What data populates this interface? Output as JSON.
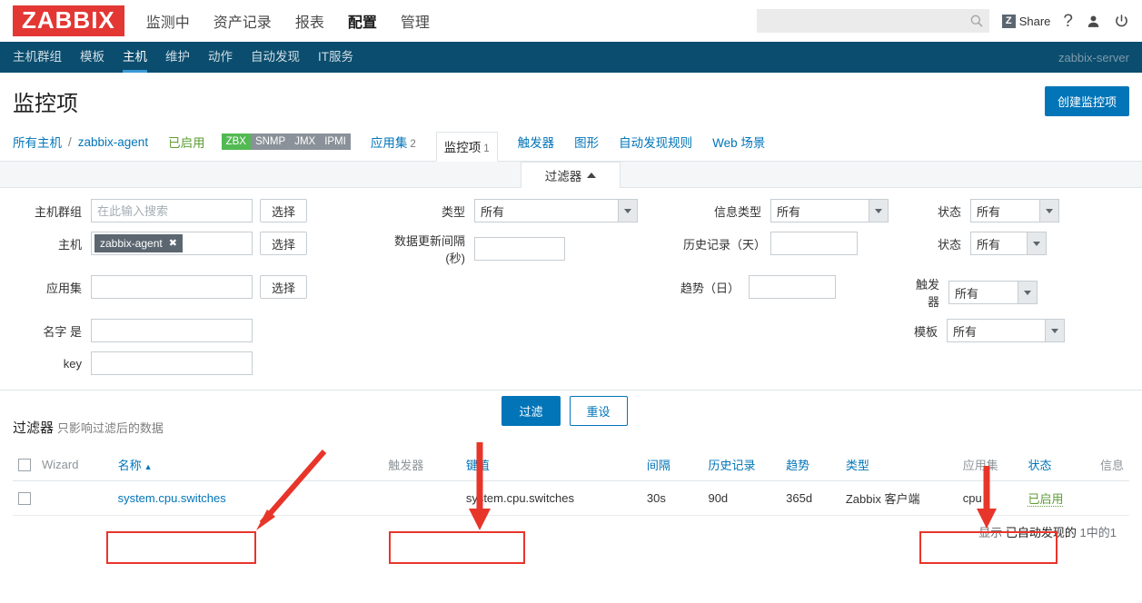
{
  "brand": {
    "logo": "ZABBIX"
  },
  "topnav": {
    "items": [
      {
        "label": "监测中",
        "active": false
      },
      {
        "label": "资产记录",
        "active": false
      },
      {
        "label": "报表",
        "active": false
      },
      {
        "label": "配置",
        "active": true
      },
      {
        "label": "管理",
        "active": false
      }
    ],
    "search_placeholder": "",
    "search_value": "",
    "search_icon": "search-icon",
    "share_label": "Share",
    "share_mark": "Z",
    "help_icon": "question-mark-icon",
    "user_icon": "user-profile-icon",
    "logout_icon": "power-off-icon"
  },
  "subnav": {
    "items": [
      {
        "label": "主机群组",
        "active": false
      },
      {
        "label": "模板",
        "active": false
      },
      {
        "label": "主机",
        "active": true
      },
      {
        "label": "维护",
        "active": false
      },
      {
        "label": "动作",
        "active": false
      },
      {
        "label": "自动发现",
        "active": false
      },
      {
        "label": "IT服务",
        "active": false
      }
    ],
    "server": "zabbix-server"
  },
  "page": {
    "title": "监控项",
    "create_button": "创建监控项"
  },
  "breadcrumb": {
    "all_hosts": "所有主机",
    "separator": "/",
    "host": "zabbix-agent",
    "state": "已启用",
    "interfaces": [
      {
        "label": "ZBX",
        "active": true
      },
      {
        "label": "SNMP",
        "active": false
      },
      {
        "label": "JMX",
        "active": false
      },
      {
        "label": "IPMI",
        "active": false
      }
    ],
    "tabs": [
      {
        "label": "应用集",
        "count": "2",
        "selected": false
      },
      {
        "label": "监控项",
        "count": "1",
        "selected": true
      },
      {
        "label": "触发器",
        "count": "",
        "selected": false
      },
      {
        "label": "图形",
        "count": "",
        "selected": false
      },
      {
        "label": "自动发现规则",
        "count": "",
        "selected": false
      },
      {
        "label": "Web 场景",
        "count": "",
        "selected": false
      }
    ]
  },
  "filter": {
    "tab_label": "过滤器",
    "tab_caret": "caret-up-icon",
    "host_group_label": "主机群组",
    "host_group_placeholder": "在此输入搜索",
    "host_group_value": "",
    "host_label": "主机",
    "host_chip": "zabbix-agent",
    "host_chip_remove": "✖",
    "app_label": "应用集",
    "app_value": "",
    "select_button": "选择",
    "name_label": "名字 是",
    "name_value": "",
    "key_label": "key",
    "key_value": "",
    "type_label": "类型",
    "type_value": "所有",
    "interval_label": "数据更新间隔(秒)",
    "interval_value": "",
    "value_type_label": "信息类型",
    "value_type_value": "所有",
    "history_label": "历史记录（天）",
    "history_value": "",
    "trends_label": "趋势（日）",
    "trends_value": "",
    "status_label": "状态",
    "status_value": "所有",
    "state_label": "状态",
    "state_value": "所有",
    "trigger_label": "触发器",
    "trigger_value": "所有",
    "template_label": "模板",
    "template_value": "所有",
    "apply_button": "过滤",
    "reset_button": "重设",
    "note_title": "过滤器",
    "note_text": "只影响过滤后的数据"
  },
  "table": {
    "headers": [
      {
        "label": "",
        "link": false
      },
      {
        "label": "Wizard",
        "link": false
      },
      {
        "label": "名称",
        "link": true,
        "sorted": "▲"
      },
      {
        "label": "触发器",
        "link": false
      },
      {
        "label": "键值",
        "link": true
      },
      {
        "label": "间隔",
        "link": true
      },
      {
        "label": "历史记录",
        "link": true
      },
      {
        "label": "趋势",
        "link": true
      },
      {
        "label": "类型",
        "link": true
      },
      {
        "label": "应用集",
        "link": false
      },
      {
        "label": "状态",
        "link": true
      },
      {
        "label": "信息",
        "link": false
      }
    ],
    "rows": [
      {
        "wizard": "",
        "name": "system.cpu.switches",
        "triggers": "",
        "key": "system.cpu.switches",
        "interval": "30s",
        "history": "90d",
        "trends": "365d",
        "type": "Zabbix 客户端",
        "application": "cpu",
        "status": "已启用",
        "info": ""
      }
    ],
    "footer_prefix": "显示",
    "footer_mid": "已自动发现的",
    "footer_count": "1中的1"
  },
  "colors": {
    "brand_red": "#e33734",
    "nav_blue": "#0b4d6e",
    "link_blue": "#0275b8",
    "green": "#5d9c34",
    "badge_green": "#53b953",
    "annotation_red": "#e8352a"
  }
}
